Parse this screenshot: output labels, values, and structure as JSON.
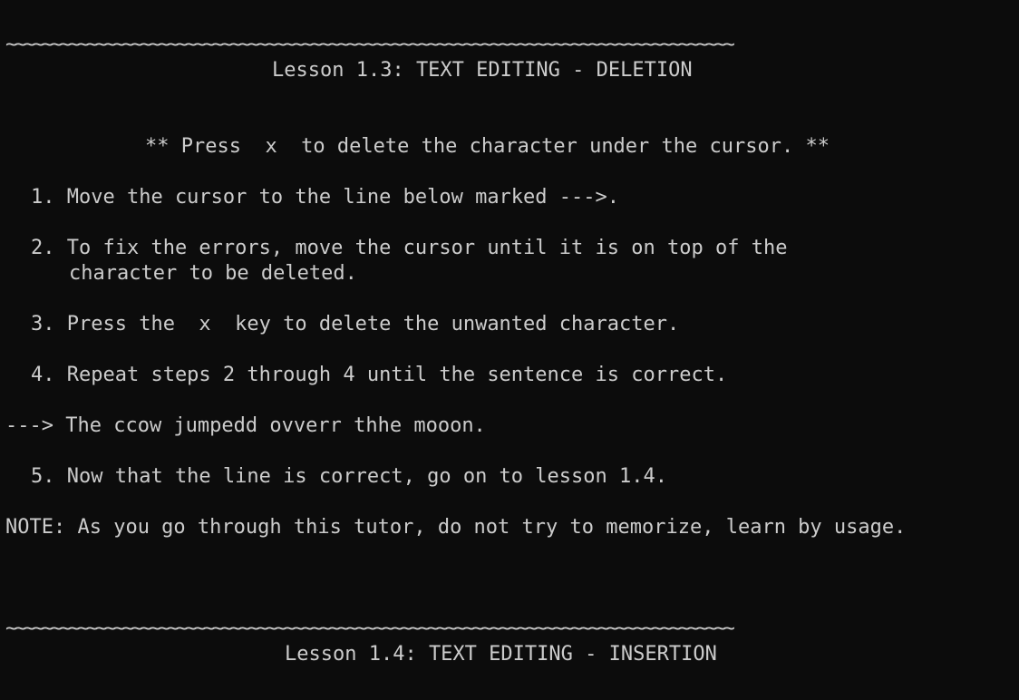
{
  "terminal": {
    "separator": "~~~~~~~~~~~~~~~~~~~~~~~~~~~~~~~~~~~~~~~~~~~~~~~~~~~~~~~~~~~~~~~~~~~~~~~~~~~~~~~~~",
    "lesson_title": "Lesson 1.3: TEXT EDITING - DELETION",
    "instruction": "** Press  x  to delete the character under the cursor. **",
    "step1": "1. Move the cursor to the line below marked --->.",
    "step2_a": "2. To fix the errors, move the cursor until it is on top of the",
    "step2_b": "character to be deleted.",
    "step3": "3. Press the  x  key to delete the unwanted character.",
    "step4": "4. Repeat steps 2 through 4 until the sentence is correct.",
    "practice_line": "---> The ccow jumpedd ovverr thhe mooon.",
    "step5": "5. Now that the line is correct, go on to lesson 1.4.",
    "note": "NOTE: As you go through this tutor, do not try to memorize, learn by usage.",
    "separator_2": "~~~~~~~~~~~~~~~~~~~~~~~~~~~~~~~~~~~~~~~~~~~~~~~~~~~~~~~~~~~~~~~~~~~~~~~~~~~~~~~~~",
    "next_lesson_title": "Lesson 1.4: TEXT EDITING - INSERTION"
  },
  "colors": {
    "background": "#0c0c0c",
    "foreground": "#cccccc"
  }
}
